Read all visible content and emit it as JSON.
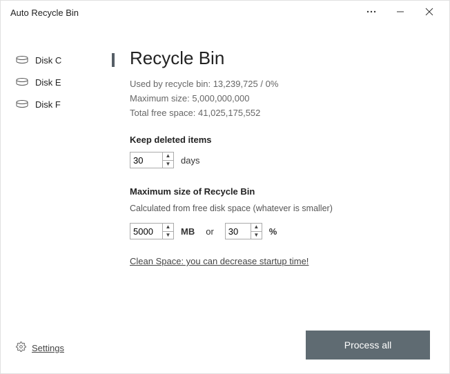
{
  "window": {
    "title": "Auto Recycle Bin"
  },
  "sidebar": {
    "items": [
      {
        "label": "Disk C",
        "active": true
      },
      {
        "label": "Disk E",
        "active": false
      },
      {
        "label": "Disk F",
        "active": false
      }
    ],
    "settings_label": "Settings"
  },
  "main": {
    "heading": "Recycle Bin",
    "used_label": "Used by recycle bin:",
    "used_value": "13,239,725 / 0%",
    "max_label": "Maximum size:",
    "max_value": "5,000,000,000",
    "free_label": "Total free space:",
    "free_value": "41,025,175,552",
    "keep_label": "Keep deleted items",
    "keep_value": "30",
    "keep_unit": "days",
    "maxsize_label": "Maximum size of Recycle Bin",
    "maxsize_sub": "Calculated from free disk space (whatever is smaller)",
    "mb_value": "5000",
    "mb_unit": "MB",
    "or_label": "or",
    "pct_value": "30",
    "pct_unit": "%",
    "clean_link": "Clean Space: you can decrease startup time!",
    "process_label": "Process all"
  }
}
